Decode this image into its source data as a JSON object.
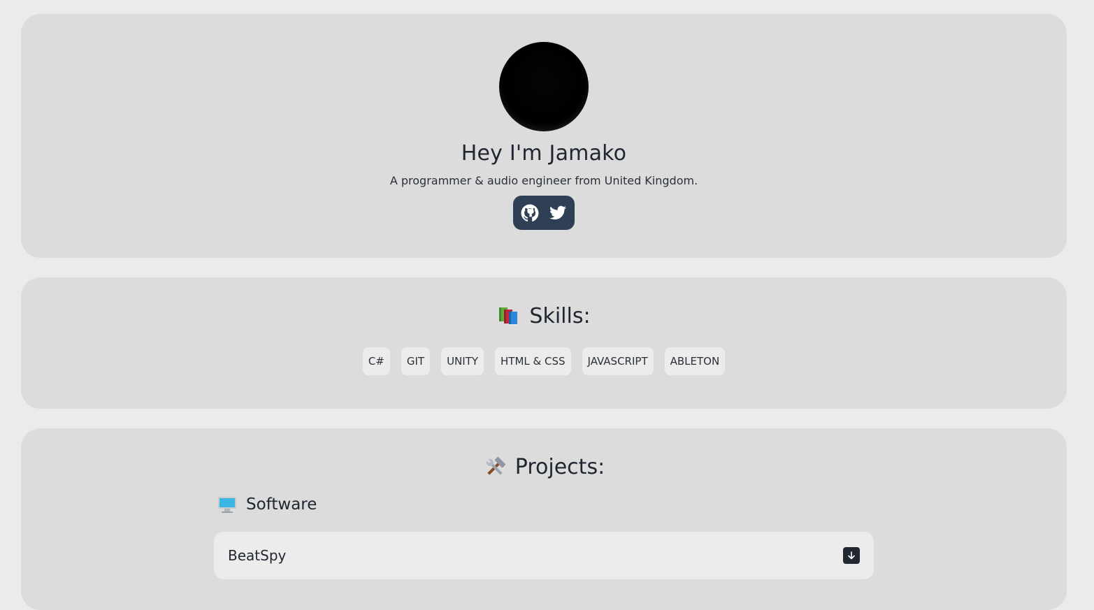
{
  "profile": {
    "title": "Hey I'm Jamako",
    "subtitle": "A programmer & audio engineer from United Kingdom.",
    "social": [
      {
        "icon": "github-icon"
      },
      {
        "icon": "twitter-icon"
      }
    ]
  },
  "skills": {
    "title": "Skills:",
    "emoji": "books-icon",
    "items": [
      "C#",
      "GIT",
      "UNITY",
      "HTML & CSS",
      "JAVASCRIPT",
      "ABLETON"
    ]
  },
  "projects": {
    "title": "Projects:",
    "emoji": "hammer-and-wrench-icon",
    "software": {
      "heading": "Software",
      "emoji": "desktop-computer-icon",
      "items": [
        {
          "name": "BeatSpy",
          "action_icon": "download-arrow-icon"
        }
      ]
    }
  },
  "colors": {
    "page_bg": "#ebebeb",
    "card_bg": "#dcdcdc",
    "chip_bg": "#ececec",
    "social_bg": "#2f3f55",
    "text": "#1f2630"
  }
}
